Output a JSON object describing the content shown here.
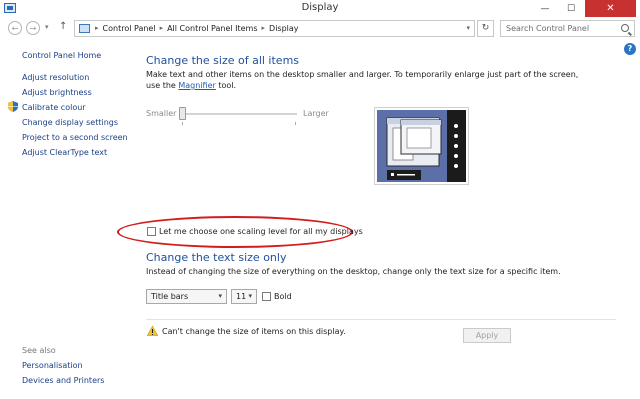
{
  "window": {
    "title": "Display",
    "minimize_glyph": "—",
    "maximize_glyph": "☐",
    "close_glyph": "✕"
  },
  "navigation": {
    "back_glyph": "←",
    "forward_glyph": "→",
    "recent_glyph": "▾",
    "up_glyph": "↑",
    "breadcrumbs": [
      "Control Panel",
      "All Control Panel Items",
      "Display"
    ],
    "separator": "▸",
    "address_dropdown_glyph": "▾",
    "refresh_glyph": "↻",
    "search_placeholder": "Search Control Panel",
    "help_glyph": "?"
  },
  "sidebar": {
    "home": "Control Panel Home",
    "items": [
      "Adjust resolution",
      "Adjust brightness",
      "Calibrate colour",
      "Change display settings",
      "Project to a second screen",
      "Adjust ClearType text"
    ],
    "see_also_label": "See also",
    "see_also_items": [
      "Personalisation",
      "Devices and Printers"
    ]
  },
  "main": {
    "size_heading": "Change the size of all items",
    "size_desc_line1": "Make text and other items on the desktop smaller and larger. To temporarily enlarge just part of the screen,",
    "size_desc_line2_prefix": "use the ",
    "size_desc_link": "Magnifier",
    "size_desc_line2_suffix": " tool.",
    "slider_min_label": "Smaller",
    "slider_max_label": "Larger",
    "slider_value": 0,
    "scaling_checkbox_label": "Let me choose one scaling level for all my displays",
    "scaling_checkbox_checked": false,
    "text_heading": "Change the text size only",
    "text_desc": "Instead of changing the size of everything on the desktop, change only the text size for a specific item.",
    "item_select_value": "Title bars",
    "size_select_value": "11",
    "bold_label": "Bold",
    "bold_checked": false,
    "warning_text": "Can't change the size of items on this display.",
    "apply_label": "Apply"
  },
  "colors": {
    "heading": "#1f4f9b",
    "link": "#1c3f86",
    "close_button": "#c7312f",
    "highlight_ellipse": "#d21d1d",
    "preview_background": "#5d6fa8"
  }
}
